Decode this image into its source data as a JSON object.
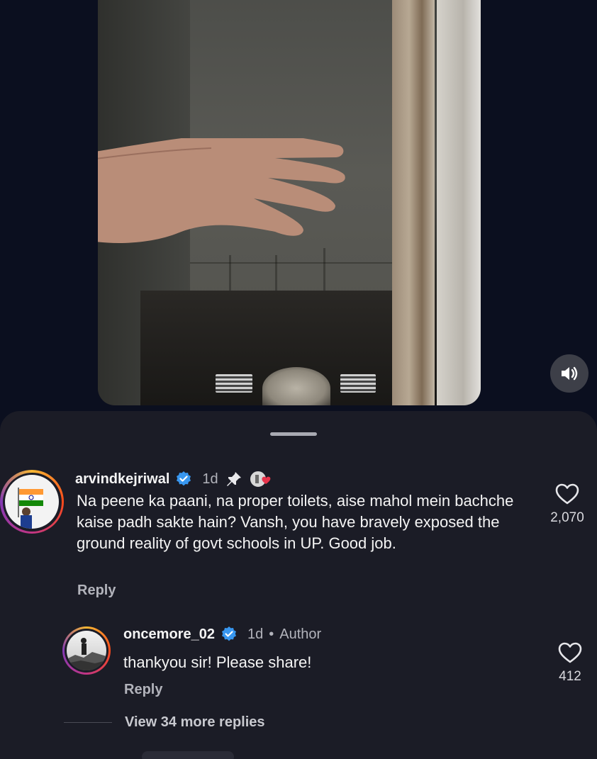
{
  "comments": [
    {
      "username": "arvindkejriwal",
      "time": "1d",
      "text": "Na peene ka paani, na proper toilets, aise mahol mein bachche kaise padh sakte hain? Vansh, you have bravely exposed the ground reality of govt schools in UP. Good job.",
      "reply_label": "Reply",
      "likes": "2,070",
      "pinned": true
    },
    {
      "username": "oncemore_02",
      "time": "1d",
      "author_label": "Author",
      "text": "thankyou sir! Please share!",
      "reply_label": "Reply",
      "likes": "412"
    }
  ],
  "view_more_replies": "View 34 more replies",
  "colors": {
    "background": "#0b0f1f",
    "sheet": "#1b1c26",
    "verified": "#3897f0",
    "liked_heart": "#e8344c"
  }
}
